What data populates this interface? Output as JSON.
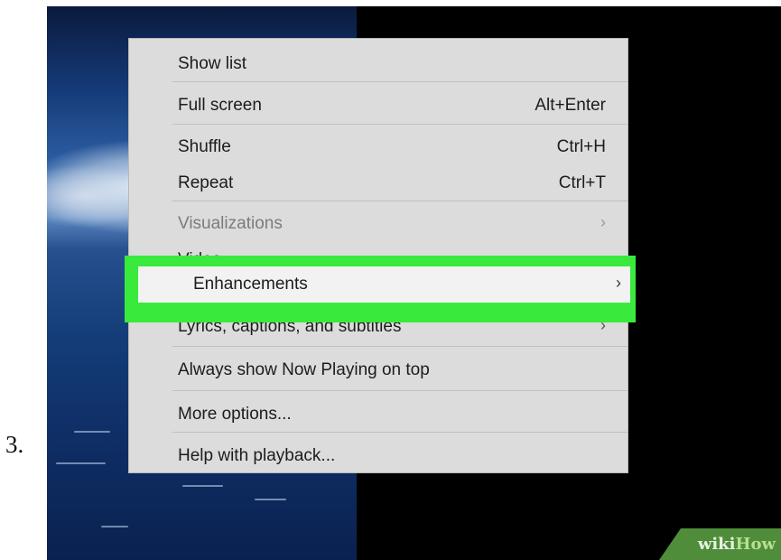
{
  "step_number": "3.",
  "menu": {
    "items": [
      {
        "label": "Show list",
        "shortcut": "",
        "submenu": false,
        "disabled": false
      },
      {
        "label": "Full screen",
        "shortcut": "Alt+Enter",
        "submenu": false,
        "disabled": false
      },
      {
        "label": "Shuffle",
        "shortcut": "Ctrl+H",
        "submenu": false,
        "disabled": false
      },
      {
        "label": "Repeat",
        "shortcut": "Ctrl+T",
        "submenu": false,
        "disabled": false
      },
      {
        "label": "Visualizations",
        "shortcut": "",
        "submenu": true,
        "disabled": true
      },
      {
        "label": "Video",
        "shortcut": "",
        "submenu": true,
        "disabled": false
      },
      {
        "label": "Enhancements",
        "shortcut": "",
        "submenu": true,
        "disabled": false,
        "highlighted": true
      },
      {
        "label": "Lyrics, captions, and subtitles",
        "shortcut": "",
        "submenu": true,
        "disabled": false
      },
      {
        "label": "Always show Now Playing on top",
        "shortcut": "",
        "submenu": false,
        "disabled": false
      },
      {
        "label": "More options...",
        "shortcut": "",
        "submenu": false,
        "disabled": false
      },
      {
        "label": "Help with playback...",
        "shortcut": "",
        "submenu": false,
        "disabled": false
      }
    ],
    "chevron": "›"
  },
  "watermark": {
    "wiki": "wiki",
    "how": "How"
  },
  "colors": {
    "highlight_border": "#39ea3c",
    "menu_bg": "#dcdcdc",
    "watermark_bg": "#4f8d3a"
  }
}
